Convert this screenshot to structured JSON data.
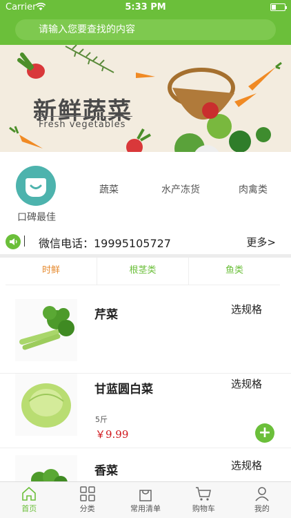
{
  "status": {
    "carrier": "Carrier",
    "time": "5:33 PM"
  },
  "search": {
    "placeholder": "请输入您要查找的内容"
  },
  "banner": {
    "title": "新鲜蔬菜",
    "subtitle": "Fresh vegetables"
  },
  "categories": [
    {
      "label": "口碑最佳"
    },
    {
      "label": "蔬菜"
    },
    {
      "label": "水产冻货"
    },
    {
      "label": "肉禽类"
    }
  ],
  "notice": {
    "phone": "微信电话：19995105727",
    "more": "更多>"
  },
  "tabs": [
    {
      "label": "时鲜"
    },
    {
      "label": "根茎类"
    },
    {
      "label": "鱼类"
    }
  ],
  "products": [
    {
      "name": "芹菜",
      "spec": "选规格"
    },
    {
      "name": "甘蓝圆白菜",
      "spec": "选规格",
      "unit": "5斤",
      "price": "￥9.99"
    },
    {
      "name": "香菜",
      "spec": "选规格"
    }
  ],
  "tabbar": [
    {
      "label": "首页"
    },
    {
      "label": "分类"
    },
    {
      "label": "常用清单"
    },
    {
      "label": "购物车"
    },
    {
      "label": "我的"
    }
  ],
  "colors": {
    "accent": "#6bbf3a",
    "active_tab": "#e68a2e",
    "price": "#d0161b"
  }
}
